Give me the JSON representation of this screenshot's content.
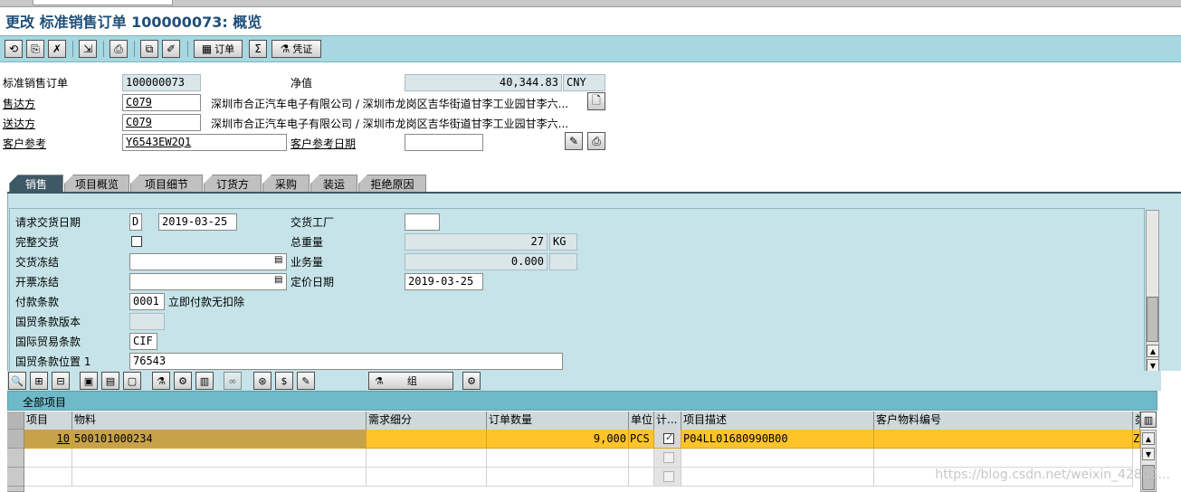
{
  "window": {
    "title": "更改 标准销售订单 100000073: 概览"
  },
  "toolbar": {
    "buttons": [
      {
        "name": "display-change-toggle-button",
        "icon": "⟳"
      },
      {
        "name": "other-document-button",
        "icon": "⎘"
      },
      {
        "name": "sign-button",
        "icon": "✎"
      },
      {
        "name": "display-doc-flow-button",
        "icon": "⇲"
      },
      {
        "name": "output-button",
        "icon": "⎙"
      },
      {
        "name": "copy-button",
        "icon": "⧉"
      },
      {
        "name": "change-button",
        "icon": "✐"
      }
    ],
    "order_label": "订单",
    "credit_label": "凭证"
  },
  "header": {
    "order_label": "标准销售订单",
    "order_value": "100000073",
    "net_value_label": "净值",
    "net_value": "40,344.83",
    "currency": "CNY",
    "sold_to_label": "售达方",
    "sold_to_value": "C079",
    "sold_to_desc": "深圳市合正汽车电子有限公司 / 深圳市龙岗区吉华街道甘李工业园甘李六...",
    "ship_to_label": "送达方",
    "ship_to_value": "C079",
    "ship_to_desc": "深圳市合正汽车电子有限公司 / 深圳市龙岗区吉华街道甘李工业园甘李六...",
    "cust_ref_label": "客户参考",
    "cust_ref_value": "Y6543EW2Q1",
    "cust_ref_date_label": "客户参考日期",
    "cust_ref_date_value": ""
  },
  "tabs": [
    "销售",
    "项目概览",
    "项目细节",
    "订货方",
    "采购",
    "装运",
    "拒绝原因"
  ],
  "sales": {
    "req_date_label": "请求交货日期",
    "req_date_type": "D",
    "req_date": "2019-03-25",
    "plant_label": "交货工厂",
    "plant_value": "",
    "complete_label": "完整交货",
    "weight_label": "总重量",
    "weight_value": "27",
    "weight_unit": "KG",
    "delivery_block_label": "交货冻结",
    "volume_label": "业务量",
    "volume_value": "0.000",
    "billing_block_label": "开票冻结",
    "pricing_date_label": "定价日期",
    "pricing_date": "2019-03-25",
    "payment_label": "付款条款",
    "payment_code": "0001",
    "payment_desc": "立即付款无扣除",
    "incoterms_version_label": "国贸条款版本",
    "incoterms_label": "国际贸易条款",
    "incoterms_value": "CIF",
    "incoterms_loc_label": "国贸条款位置 1",
    "incoterms_loc_value": "76543"
  },
  "table_toolbar": {
    "group_label": "组"
  },
  "items_table": {
    "title": "全部项目",
    "columns": [
      "项目",
      "物料",
      "需求细分",
      "订单数量",
      "单位",
      "计...",
      "项目描述",
      "客户物料编号",
      "类"
    ],
    "rows": [
      {
        "item": "10",
        "material": "500101000234",
        "req_seg": "",
        "qty": "9,000",
        "unit": "PCS",
        "calc": true,
        "desc": "P04LL01680990B00",
        "cust_mat": "",
        "cat": "Z"
      }
    ]
  },
  "watermark": "https://blog.csdn.net/weixin_42808..."
}
